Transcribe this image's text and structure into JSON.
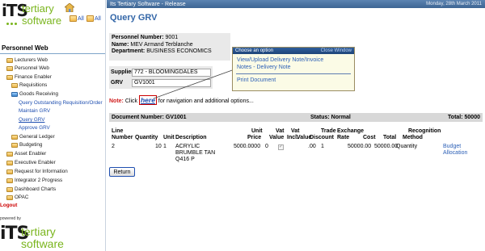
{
  "app": {
    "header_title": "Its Tertiary Software - Release",
    "date": "Monday, 28th March 2011"
  },
  "brand": {
    "its": "iTS",
    "tertiary": "tertiary",
    "software": "software",
    "powered_by": "powered by",
    "colors": {
      "green": "#7ab51d",
      "dark": "#1a1a1a"
    }
  },
  "quick_links": {
    "all_1": "All",
    "all_2": "All"
  },
  "nav": {
    "title": "Personnel Web",
    "items": [
      {
        "label": "Lecturers Web"
      },
      {
        "label": "Personnel Web"
      },
      {
        "label": "Finance Enabler"
      },
      {
        "label": "Requisitions"
      },
      {
        "label": "Goods Receiving"
      },
      {
        "label": "Query Outstanding Requisition/Order"
      },
      {
        "label": "Maintain GRV"
      },
      {
        "label": "Query GRV"
      },
      {
        "label": "Approve GRV"
      },
      {
        "label": "General Ledger"
      },
      {
        "label": "Budgeting"
      },
      {
        "label": "Asset Enabler"
      },
      {
        "label": "Executive Enabler"
      },
      {
        "label": "Request for Information"
      },
      {
        "label": "Integrator 2 Progress"
      },
      {
        "label": "Dashboard Charts"
      },
      {
        "label": "OPAC"
      }
    ],
    "logout": "Logout"
  },
  "page": {
    "title": "Query GRV",
    "person": {
      "number_label": "Personnel Number:",
      "number": "9001",
      "name_label": "Name:",
      "name": "MEV Armand Terblanche",
      "dept_label": "Department:",
      "dept": "BUSINESS ECONOMICS"
    },
    "supplier_label": "Supplier",
    "supplier": "772 - BLOOMINGDALES",
    "grv_label": "GRV",
    "grv": "GV1001",
    "note_label": "Note:",
    "note_pre": "Click",
    "note_here": "here",
    "note_post": "for navigation and additional options..."
  },
  "popup": {
    "title": "Choose an option",
    "close": "Close Window",
    "options": [
      "View/Upload Delivery Note/Invoice",
      "Notes - Delivery Note",
      "Print Document"
    ]
  },
  "doc": {
    "number": "Document Number: GV1001",
    "status": "Status: Normal",
    "total": "Total: 50000"
  },
  "table": {
    "headers": {
      "line_number_1": "Line",
      "line_number_2": "Number",
      "quantity": "Quantity",
      "unit": "Unit",
      "description": "Description",
      "unit_price_1": "Unit",
      "unit_price_2": "Price",
      "vat_1": "Vat",
      "vat_2": "Value",
      "vat_incl_1": "Vat",
      "vat_incl_2": "Incl.",
      "trade_discount_1": "Trade",
      "trade_discount_2": "Discount",
      "exchange_rate_1": "Exchange",
      "exchange_rate_2": "Rate",
      "cost": "Cost",
      "total": "Total",
      "recognition_1": "Recognition",
      "recognition_2": "Method"
    },
    "rows": [
      {
        "line": "2",
        "quantity": "10",
        "unit": "1",
        "description": [
          "ACRYLIC",
          "BRUMBLE TAN",
          "Q416 P"
        ],
        "unit_price": "5000.0000",
        "vat_value": "0",
        "vat_incl": true,
        "trade_discount": ".00",
        "exchange_rate": "1",
        "cost": "50000.00",
        "total": "50000.00",
        "recognition": "Quantity",
        "action": [
          "Budget",
          "Allocation"
        ]
      }
    ]
  },
  "buttons": {
    "return": "Return"
  }
}
